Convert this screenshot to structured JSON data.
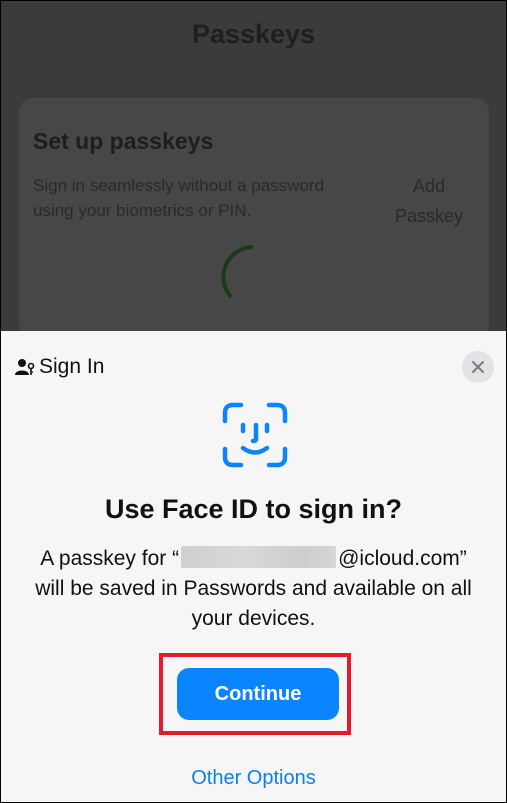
{
  "background": {
    "title": "Passkeys",
    "card_title": "Set up passkeys",
    "card_description": "Sign in seamlessly without a password using your biometrics or PIN.",
    "add_label": "Add Passkey"
  },
  "sheet": {
    "title": "Sign In",
    "headline": "Use Face ID to sign in?",
    "body_prefix": "A passkey for “",
    "body_suffix": "@icloud.com” will be saved in Passwords and available on all your devices.",
    "continue_label": "Continue",
    "other_options_label": "Other Options"
  },
  "icons": {
    "person": "person-key-icon",
    "close": "close-icon",
    "faceid": "face-id-icon",
    "spinner": "loading-spinner-icon"
  },
  "colors": {
    "accent": "#0a84ff",
    "link": "#0a7ff5",
    "highlight": "#e31b2d",
    "sheet_bg": "#f6f6f6",
    "dim_bg": "#3b3b3b"
  }
}
